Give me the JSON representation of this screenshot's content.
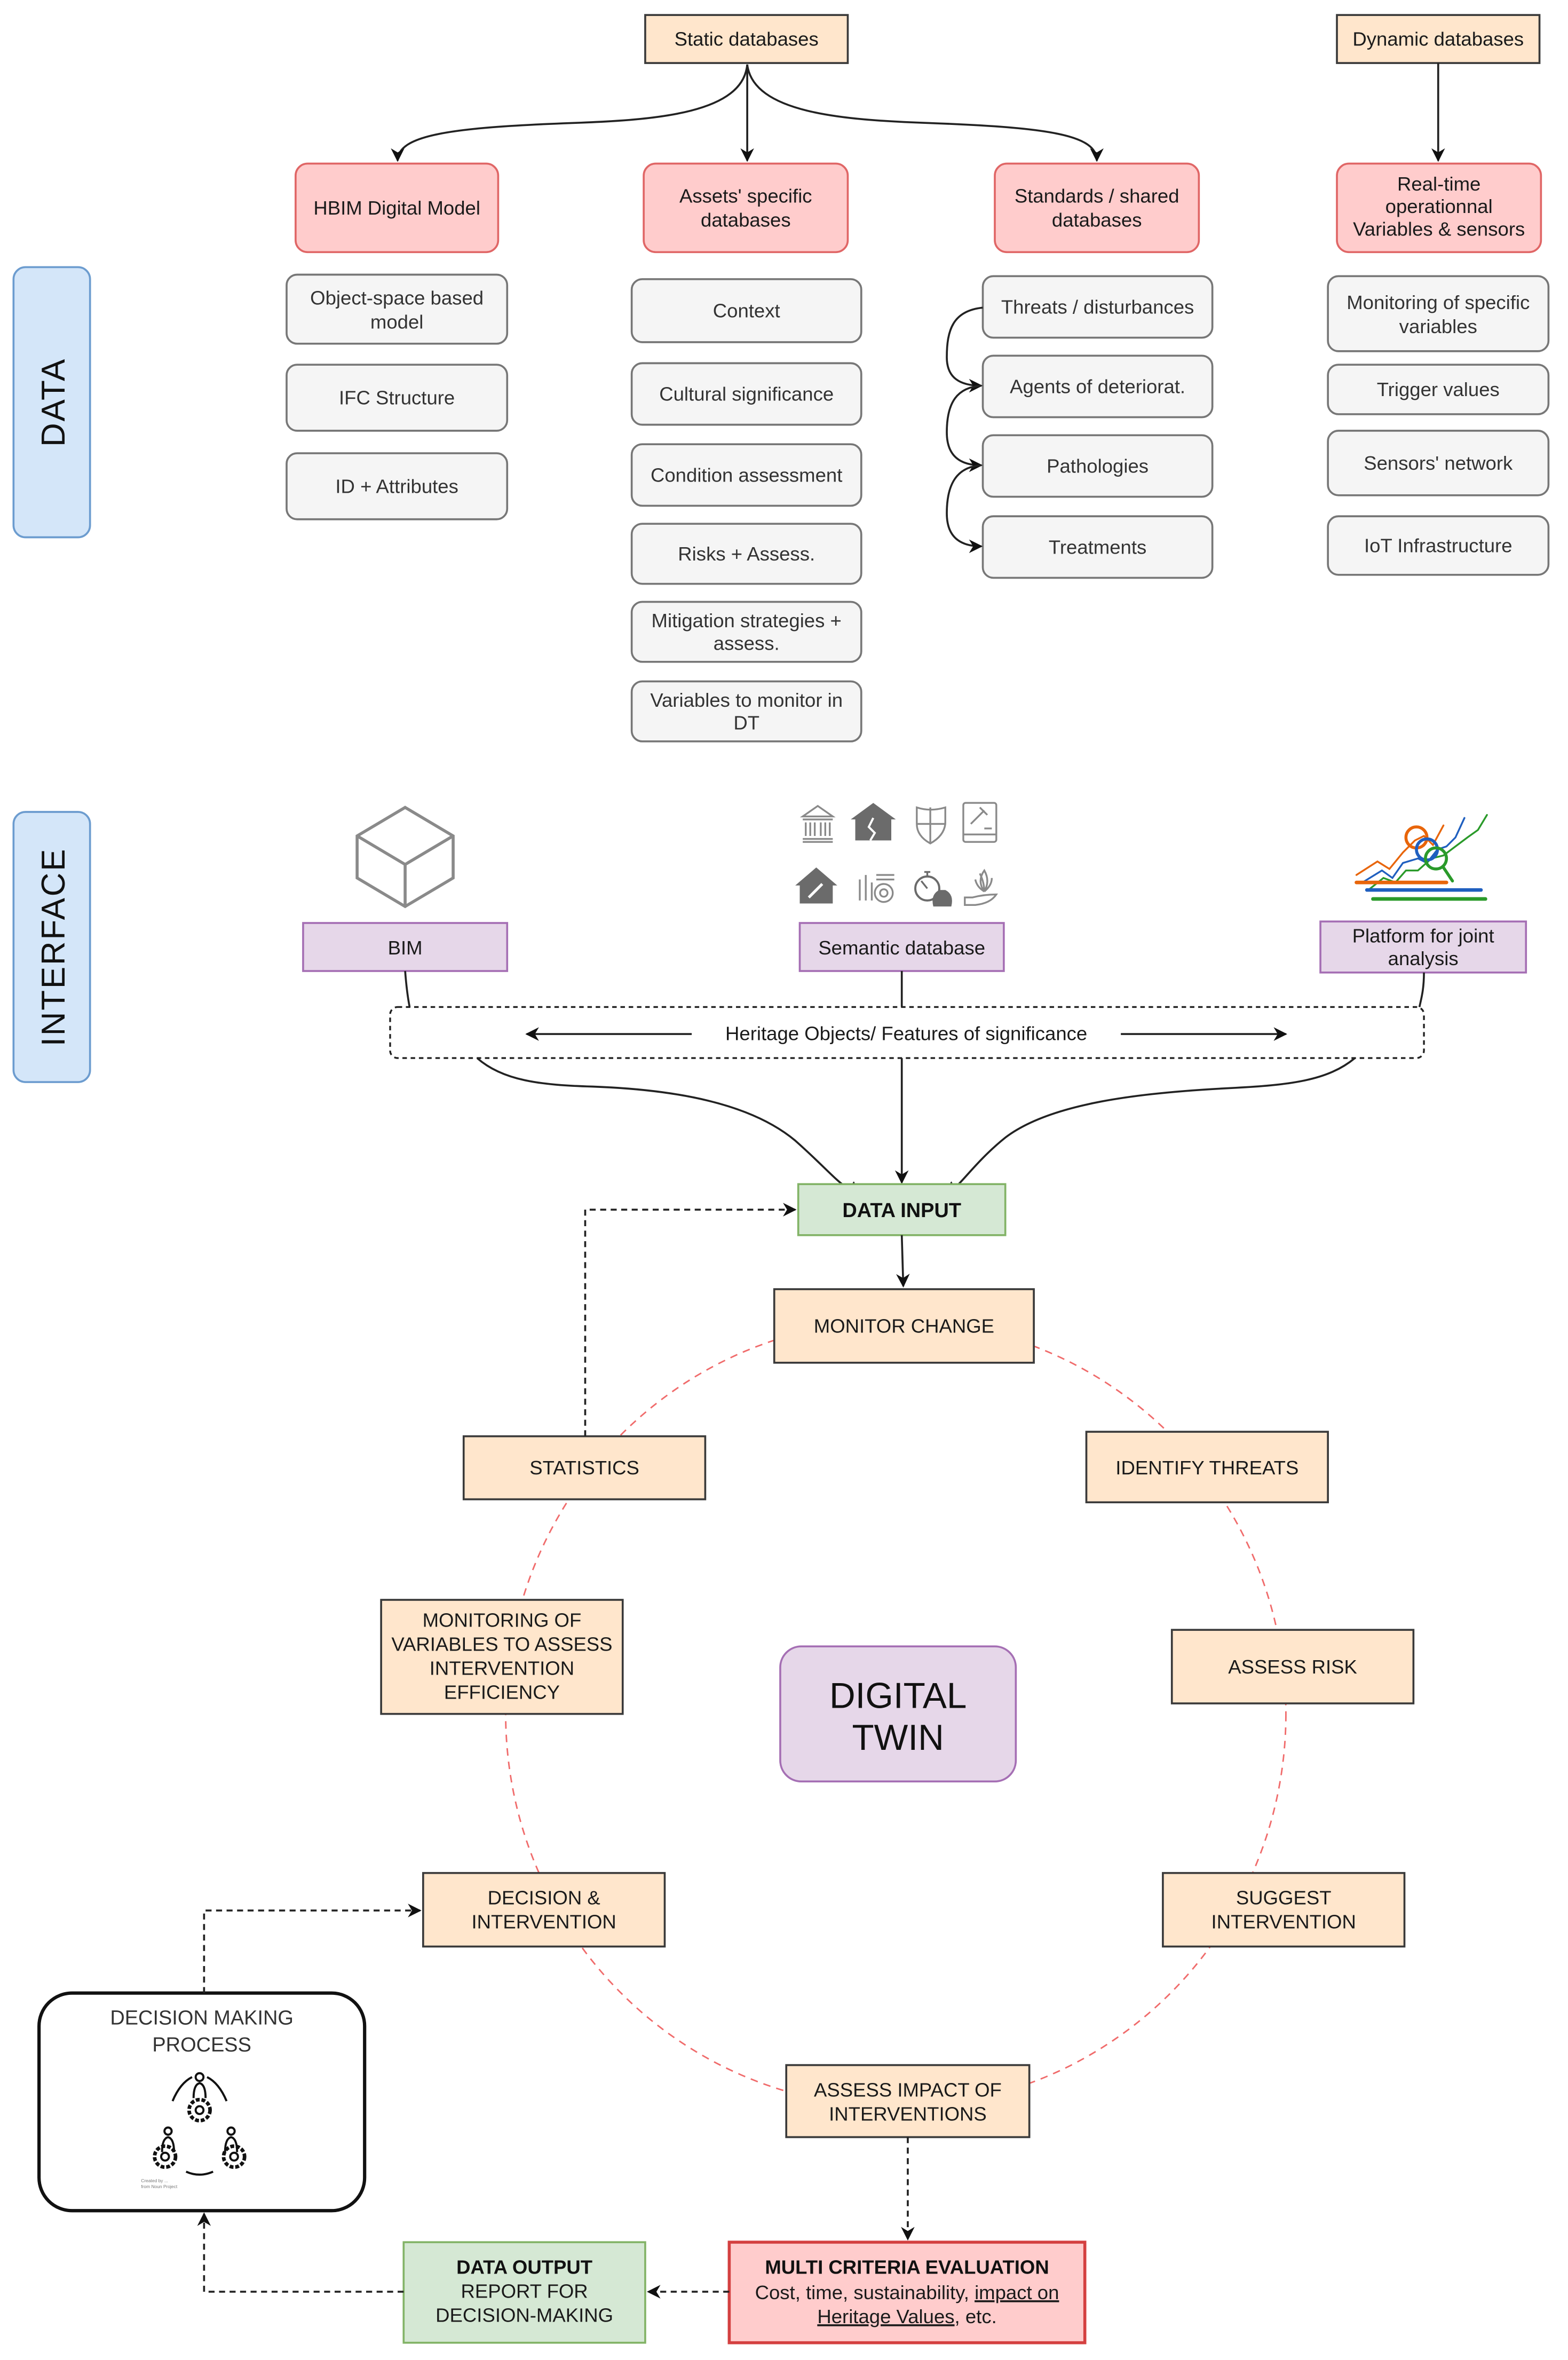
{
  "sections": {
    "data_label": "DATA",
    "interface_label": "INTERFACE"
  },
  "data_layer": {
    "static_root": "Static databases",
    "dynamic_root": "Dynamic databases",
    "columns": [
      {
        "header_lines": [
          "HBIM Digital Model"
        ],
        "items": [
          {
            "lines": [
              "Object-space based",
              "model"
            ]
          },
          {
            "lines": [
              "IFC Structure"
            ]
          },
          {
            "lines": [
              "ID + Attributes"
            ]
          }
        ]
      },
      {
        "header_lines": [
          "Assets' specific",
          "databases"
        ],
        "items": [
          {
            "lines": [
              "Context"
            ]
          },
          {
            "lines": [
              "Cultural significance"
            ]
          },
          {
            "lines": [
              "Condition assessment"
            ]
          },
          {
            "lines": [
              "Risks + Assess."
            ]
          },
          {
            "lines": [
              "Mitigation strategies +",
              "assess."
            ]
          },
          {
            "lines": [
              "Variables to monitor in",
              "DT"
            ]
          }
        ]
      },
      {
        "header_lines": [
          "Standards / shared",
          "databases"
        ],
        "items": [
          {
            "lines": [
              "Threats / disturbances"
            ]
          },
          {
            "lines": [
              "Agents of deteriorat."
            ]
          },
          {
            "lines": [
              "Pathologies"
            ]
          },
          {
            "lines": [
              "Treatments"
            ]
          }
        ]
      },
      {
        "header_lines": [
          "Real-time",
          "operationnal",
          "Variables & sensors"
        ],
        "items": [
          {
            "lines": [
              "Monitoring of specific",
              "variables"
            ]
          },
          {
            "lines": [
              "Trigger values"
            ]
          },
          {
            "lines": [
              "Sensors' network"
            ]
          },
          {
            "lines": [
              "IoT Infrastructure"
            ]
          }
        ]
      }
    ]
  },
  "interface_layer": {
    "bim_label": "BIM",
    "semantic_label": "Semantic database",
    "platform_lines": [
      "Platform for joint",
      "analysis"
    ],
    "heritage_band": "Heritage Objects/ Features of significance",
    "semantic_icons": [
      "classical-building-icon",
      "cracked-house-icon",
      "shield-icon",
      "law-book-icon",
      "house-repair-icon",
      "tools-gear-icon",
      "time-money-icon",
      "hand-plant-icon"
    ],
    "platform_icon_colors": [
      "#e8650a",
      "#1f5fbf",
      "#2a9a2a"
    ]
  },
  "cycle": {
    "center_lines": [
      "DIGITAL",
      "TWIN"
    ],
    "data_input": "DATA INPUT",
    "steps": [
      {
        "id": "monitor-change",
        "lines": [
          "MONITOR CHANGE"
        ]
      },
      {
        "id": "identify-threats",
        "lines": [
          "IDENTIFY THREATS"
        ]
      },
      {
        "id": "assess-risk",
        "lines": [
          "ASSESS RISK"
        ]
      },
      {
        "id": "suggest-intervention",
        "lines": [
          "SUGGEST",
          "INTERVENTION"
        ]
      },
      {
        "id": "assess-impact",
        "lines": [
          "ASSESS IMPACT OF",
          "INTERVENTIONS"
        ]
      },
      {
        "id": "decision-intervention",
        "lines": [
          "DECISION &",
          "INTERVENTION"
        ]
      },
      {
        "id": "monitoring-variables",
        "lines": [
          "MONITORING OF",
          "VARIABLES TO ASSESS",
          "INTERVENTION",
          "EFFICIENCY"
        ]
      },
      {
        "id": "statistics",
        "lines": [
          "STATISTICS"
        ]
      }
    ]
  },
  "output": {
    "mce_title": "MULTI CRITERIA EVALUATION",
    "mce_line2_plain": "Cost, time, sustainability, ",
    "mce_line2_underlined": "impact on",
    "mce_line3_underlined": "Heritage Values",
    "mce_line3_plain": ", etc.",
    "data_output_title": "DATA OUTPUT",
    "data_output_lines": [
      "REPORT FOR",
      "DECISION-MAKING"
    ],
    "decision_process_lines": [
      "DECISION MAKING",
      "PROCESS"
    ],
    "icon_credit_lines": [
      "Created by ...",
      "from Noun Project"
    ]
  },
  "colors": {
    "orange_fill": "#ffe6cc",
    "red_fill": "#ffcccc",
    "purple_fill": "#e6d7e9",
    "green_fill": "#d5e8d4",
    "blue_fill": "#d4e6f9",
    "gray_fill": "#f5f5f5",
    "cycle_dash": "#f06b6b"
  }
}
